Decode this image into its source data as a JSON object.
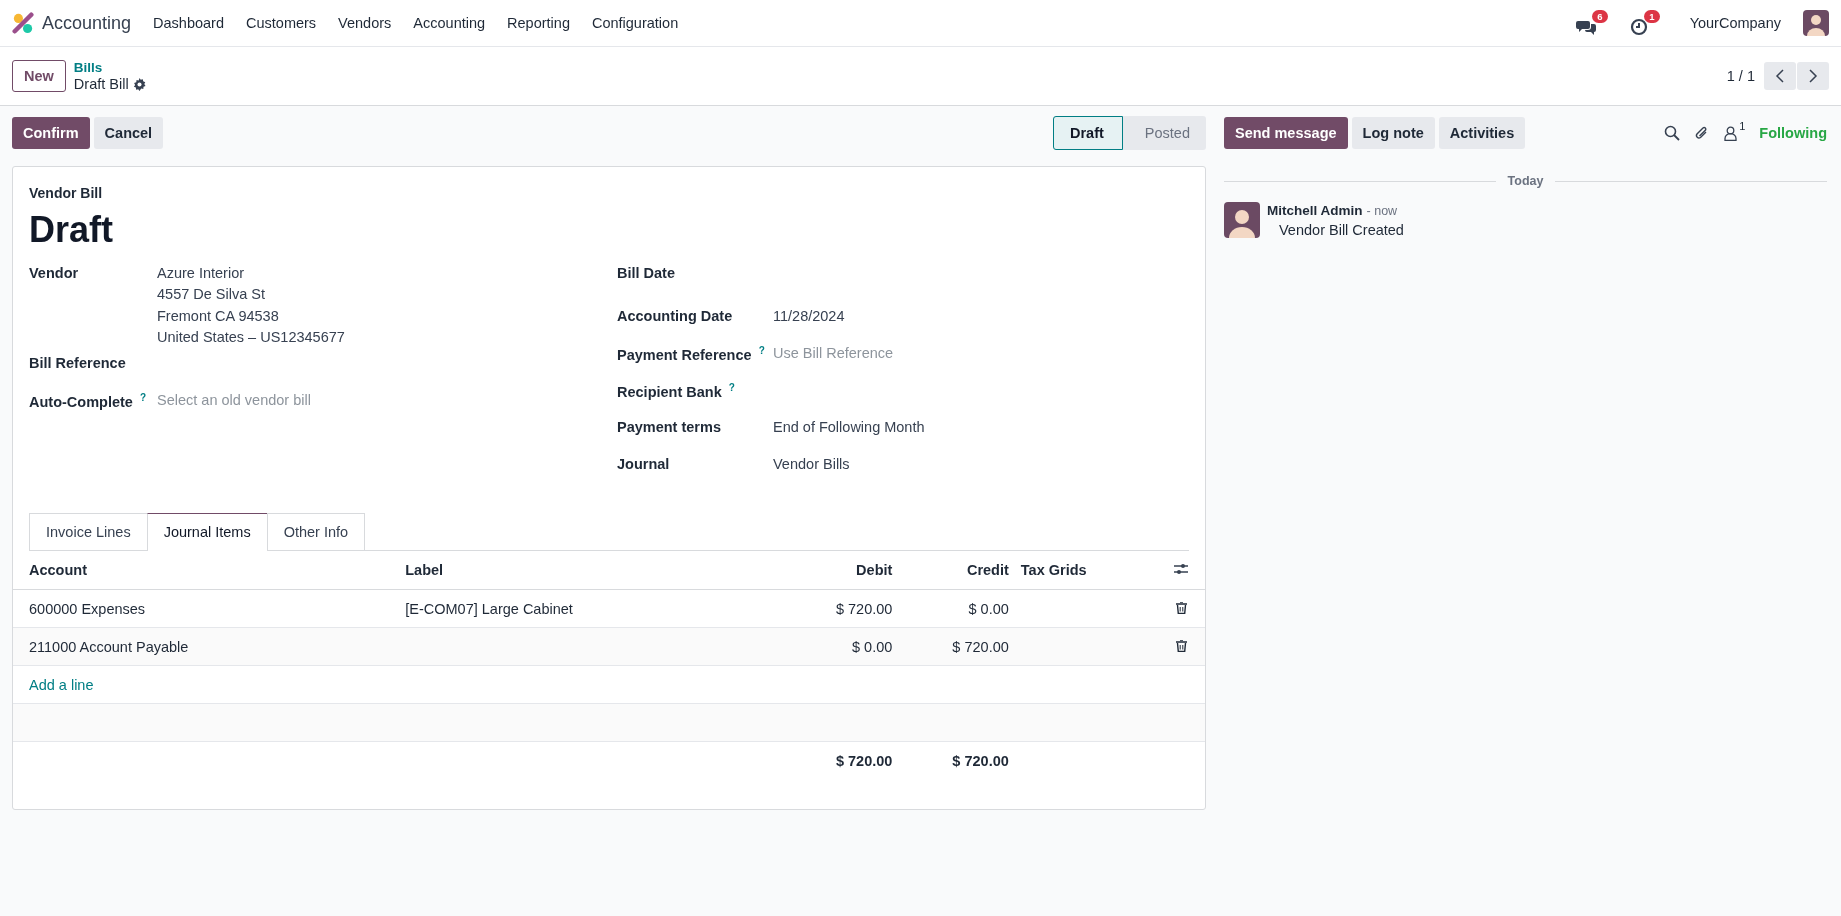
{
  "navbar": {
    "app_name": "Accounting",
    "menu": [
      "Dashboard",
      "Customers",
      "Vendors",
      "Accounting",
      "Reporting",
      "Configuration"
    ],
    "messages_badge": "6",
    "activities_badge": "1",
    "company": "YourCompany"
  },
  "control_panel": {
    "new_button": "New",
    "breadcrumb": "Bills",
    "record_title": "Draft Bill",
    "pager": "1 / 1"
  },
  "actions": [
    {
      "label": "Confirm",
      "kind": "primary"
    },
    {
      "label": "Cancel",
      "kind": "secondary"
    }
  ],
  "statusbar": [
    {
      "label": "Draft",
      "selected": true
    },
    {
      "label": "Posted",
      "selected": false
    }
  ],
  "form": {
    "type_label": "Vendor Bill",
    "title": "Draft",
    "left_fields": [
      {
        "label": "Vendor",
        "lines": [
          "Azure Interior",
          "4557 De Silva St",
          "Fremont CA 94538",
          "United States – US12345677"
        ]
      },
      {
        "label": "Bill Reference"
      },
      {
        "label": "Auto-Complete",
        "help": "?",
        "placeholder": "Select an old vendor bill"
      }
    ],
    "right_fields": [
      {
        "label": "Bill Date"
      },
      {
        "label": "Accounting Date",
        "value": "11/28/2024"
      },
      {
        "label": "Payment Reference",
        "help": "?",
        "placeholder": "Use Bill Reference"
      },
      {
        "label": "Recipient Bank",
        "help": "?"
      },
      {
        "label": "Payment terms",
        "value": "End of Following Month"
      },
      {
        "label": "Journal",
        "value": "Vendor Bills"
      }
    ]
  },
  "tabs": [
    {
      "label": "Invoice Lines",
      "selected": false
    },
    {
      "label": "Journal Items",
      "selected": true
    },
    {
      "label": "Other Info",
      "selected": false
    }
  ],
  "table": {
    "columns": [
      {
        "label": "Account",
        "kind": "text"
      },
      {
        "label": "Label",
        "kind": "text"
      },
      {
        "label": "Debit",
        "kind": "amount"
      },
      {
        "label": "Credit",
        "kind": "amount"
      },
      {
        "label": "Tax Grids",
        "kind": "text"
      }
    ],
    "rows": [
      {
        "cells": [
          "600000 Expenses",
          "[E-COM07] Large Cabinet",
          "$ 720.00",
          "$ 0.00",
          ""
        ]
      },
      {
        "cells": [
          "211000 Account Payable",
          "",
          "$ 0.00",
          "$ 720.00",
          ""
        ]
      }
    ],
    "add_line": "Add a line",
    "totals": [
      "$ 720.00",
      "$ 720.00"
    ]
  },
  "chatter": {
    "buttons": [
      {
        "label": "Send message",
        "kind": "primary"
      },
      {
        "label": "Log note",
        "kind": "secondary"
      },
      {
        "label": "Activities",
        "kind": "secondary"
      }
    ],
    "followers_count": "1",
    "follow_state": "Following",
    "date_separator": "Today",
    "messages": [
      {
        "author": "Mitchell Admin",
        "time": "- now",
        "body": "Vendor Bill Created"
      }
    ]
  }
}
